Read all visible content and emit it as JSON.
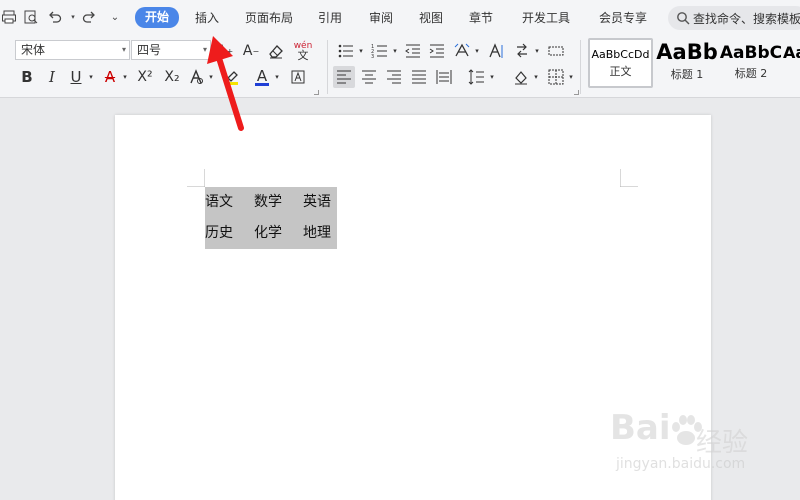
{
  "menubar": {
    "tabs": [
      {
        "label": "开始",
        "active": true
      },
      {
        "label": "插入"
      },
      {
        "label": "页面布局"
      },
      {
        "label": "引用"
      },
      {
        "label": "审阅"
      },
      {
        "label": "视图"
      },
      {
        "label": "章节"
      },
      {
        "label": "开发工具"
      },
      {
        "label": "会员专享"
      }
    ],
    "search_placeholder": "查找命令、搜索模板",
    "quick_access_icons": [
      "print-icon",
      "print-preview-icon",
      "undo-icon",
      "redo-icon",
      "customize-icon"
    ]
  },
  "ribbon": {
    "font_name": "宋体",
    "font_size": "四号",
    "bold_glyph": "B",
    "italic_glyph": "I",
    "underline_glyph": "U",
    "strike_glyph": "A",
    "superscript_glyph": "X²",
    "subscript_glyph": "X₂",
    "font_color_glyph": "A",
    "phonetic_glyph": "wén",
    "styles": [
      {
        "sample": "AaBbCcDd",
        "name": "正文",
        "selected": true
      },
      {
        "sample": "AaBb",
        "name": "标题 1"
      },
      {
        "sample": "AaBbC",
        "name": "标题 2"
      },
      {
        "sample": "Aa",
        "name": ""
      }
    ]
  },
  "document": {
    "table": [
      [
        "语文",
        "数学",
        "英语"
      ],
      [
        "历史",
        "化学",
        "地理"
      ]
    ]
  },
  "watermark": {
    "brand": "Bai",
    "brand_suffix": "经验",
    "url": "jingyan.baidu.com"
  },
  "colors": {
    "accent": "#4a86e8",
    "arrow": "#ee1c1c",
    "selection": "#c5c5c5",
    "font_color_bar": "#1f3fd6"
  }
}
